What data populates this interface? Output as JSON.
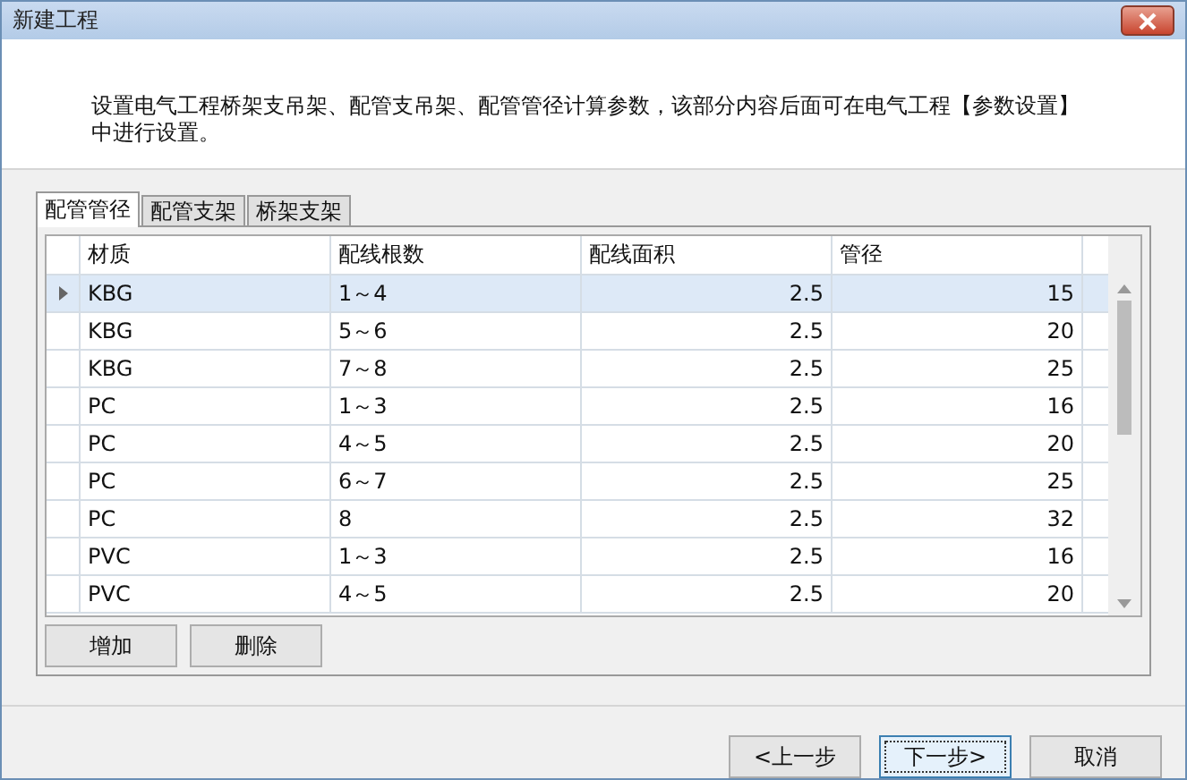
{
  "window": {
    "title": "新建工程"
  },
  "description": "设置电气工程桥架支吊架、配管支吊架、配管管径计算参数，该部分内容后面可在电气工程【参数设置】中进行设置。",
  "tabs": [
    {
      "label": "配管管径",
      "selected": true
    },
    {
      "label": "配管支架",
      "selected": false
    },
    {
      "label": "桥架支架",
      "selected": false
    }
  ],
  "table": {
    "columns": [
      "材质",
      "配线根数",
      "配线面积",
      "管径"
    ],
    "rows": [
      {
        "cells": [
          "KBG",
          "1～4",
          "2.5",
          "15"
        ],
        "selected": true
      },
      {
        "cells": [
          "KBG",
          "5～6",
          "2.5",
          "20"
        ],
        "selected": false
      },
      {
        "cells": [
          "KBG",
          "7～8",
          "2.5",
          "25"
        ],
        "selected": false
      },
      {
        "cells": [
          "PC",
          "1～3",
          "2.5",
          "16"
        ],
        "selected": false
      },
      {
        "cells": [
          "PC",
          "4～5",
          "2.5",
          "20"
        ],
        "selected": false
      },
      {
        "cells": [
          "PC",
          "6～7",
          "2.5",
          "25"
        ],
        "selected": false
      },
      {
        "cells": [
          "PC",
          "8",
          "2.5",
          "32"
        ],
        "selected": false
      },
      {
        "cells": [
          "PVC",
          "1～3",
          "2.5",
          "16"
        ],
        "selected": false
      },
      {
        "cells": [
          "PVC",
          "4～5",
          "2.5",
          "20"
        ],
        "selected": false
      }
    ]
  },
  "grid_buttons": [
    "增加",
    "删除"
  ],
  "footer_buttons": [
    {
      "label": "<上一步",
      "focused": false
    },
    {
      "label": "下一步>",
      "focused": true
    },
    {
      "label": "取消",
      "focused": false
    }
  ]
}
